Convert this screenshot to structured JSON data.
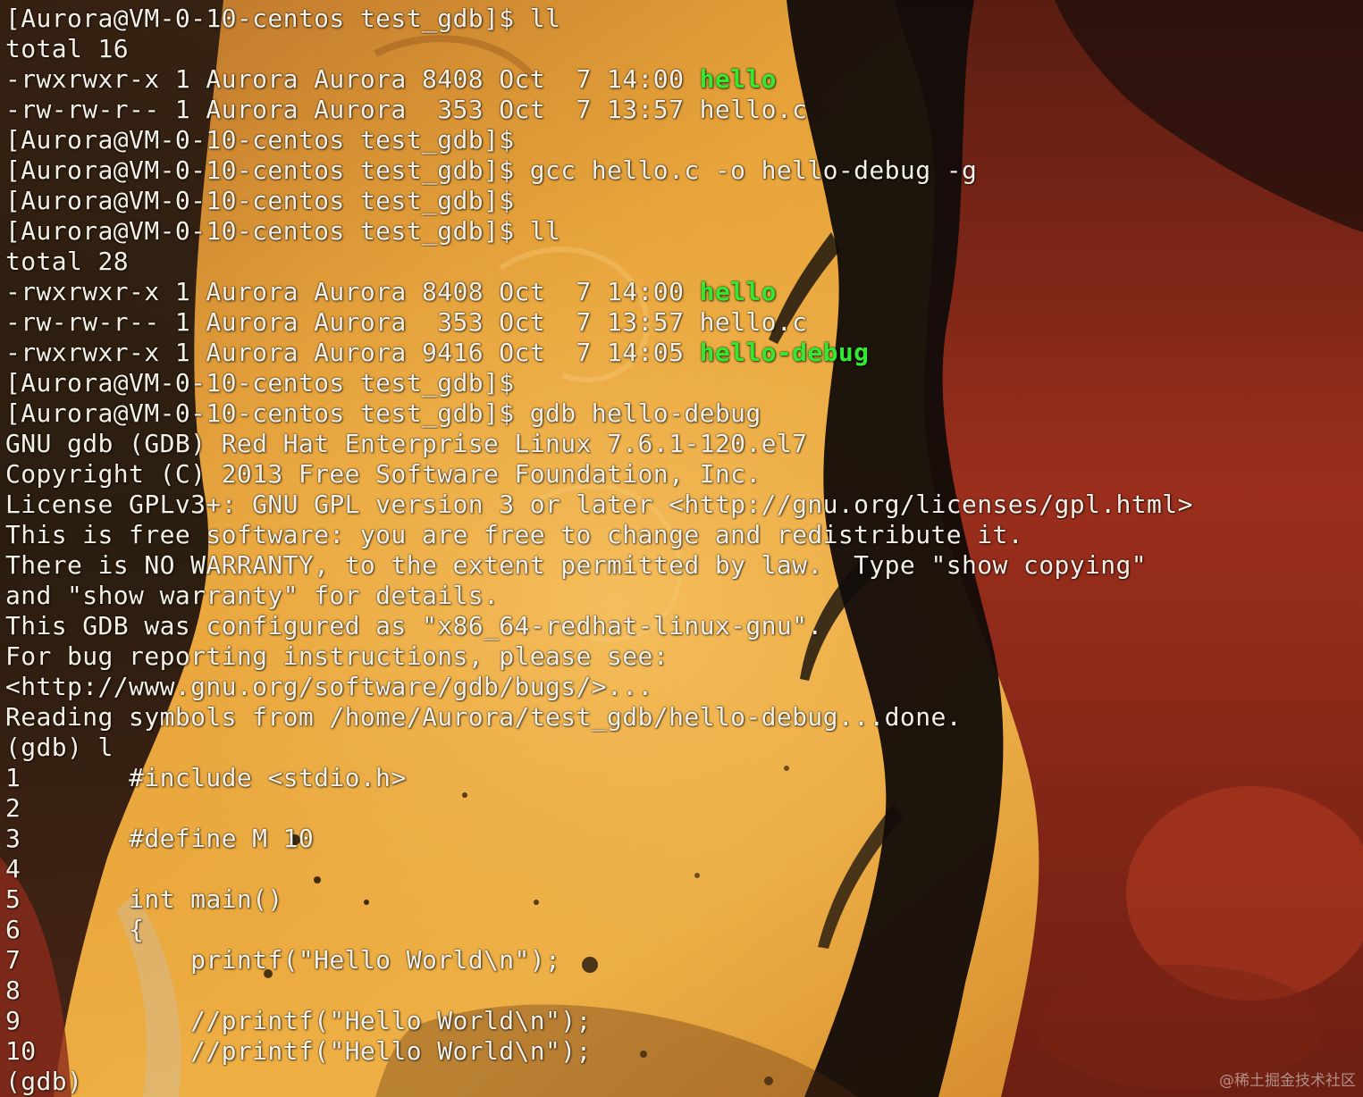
{
  "colors": {
    "text": "#f4f0e6",
    "executable_highlight": "#34e82f",
    "background_dark": "#0e0b0a",
    "background_amber": "#e9a53a",
    "background_red": "#9b2e1c"
  },
  "terminal": {
    "lines": [
      {
        "text": "[Aurora@VM-0-10-centos test_gdb]$ ll"
      },
      {
        "text": "total 16"
      },
      {
        "text": "-rwxrwxr-x 1 Aurora Aurora 8408 Oct  7 14:00 ",
        "highlight": "hello"
      },
      {
        "text": "-rw-rw-r-- 1 Aurora Aurora  353 Oct  7 13:57 hello.c"
      },
      {
        "text": "[Aurora@VM-0-10-centos test_gdb]$"
      },
      {
        "text": "[Aurora@VM-0-10-centos test_gdb]$ gcc hello.c -o hello-debug -g"
      },
      {
        "text": "[Aurora@VM-0-10-centos test_gdb]$"
      },
      {
        "text": "[Aurora@VM-0-10-centos test_gdb]$ ll"
      },
      {
        "text": "total 28"
      },
      {
        "text": "-rwxrwxr-x 1 Aurora Aurora 8408 Oct  7 14:00 ",
        "highlight": "hello"
      },
      {
        "text": "-rw-rw-r-- 1 Aurora Aurora  353 Oct  7 13:57 hello.c"
      },
      {
        "text": "-rwxrwxr-x 1 Aurora Aurora 9416 Oct  7 14:05 ",
        "highlight": "hello-debug"
      },
      {
        "text": "[Aurora@VM-0-10-centos test_gdb]$"
      },
      {
        "text": "[Aurora@VM-0-10-centos test_gdb]$ gdb hello-debug"
      },
      {
        "text": "GNU gdb (GDB) Red Hat Enterprise Linux 7.6.1-120.el7"
      },
      {
        "text": "Copyright (C) 2013 Free Software Foundation, Inc."
      },
      {
        "text": "License GPLv3+: GNU GPL version 3 or later <http://gnu.org/licenses/gpl.html>"
      },
      {
        "text": "This is free software: you are free to change and redistribute it."
      },
      {
        "text": "There is NO WARRANTY, to the extent permitted by law.  Type \"show copying\""
      },
      {
        "text": "and \"show warranty\" for details."
      },
      {
        "text": "This GDB was configured as \"x86_64-redhat-linux-gnu\"."
      },
      {
        "text": "For bug reporting instructions, please see:"
      },
      {
        "text": "<http://www.gnu.org/software/gdb/bugs/>..."
      },
      {
        "text": "Reading symbols from /home/Aurora/test_gdb/hello-debug...done."
      },
      {
        "text": "(gdb) l"
      },
      {
        "text": "1\t#include <stdio.h>"
      },
      {
        "text": "2"
      },
      {
        "text": "3\t#define M 10"
      },
      {
        "text": "4"
      },
      {
        "text": "5\tint main()"
      },
      {
        "text": "6\t{"
      },
      {
        "text": "7\t    printf(\"Hello World\\n\");"
      },
      {
        "text": "8"
      },
      {
        "text": "9\t    //printf(\"Hello World\\n\");"
      },
      {
        "text": "10\t    //printf(\"Hello World\\n\");"
      },
      {
        "text": "(gdb) "
      }
    ]
  },
  "watermark": {
    "text": "@稀土掘金技术社区"
  }
}
